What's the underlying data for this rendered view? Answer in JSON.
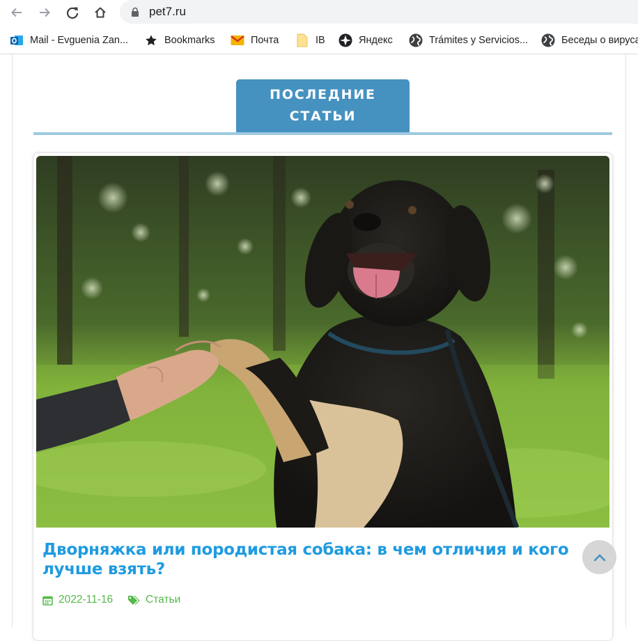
{
  "browser": {
    "url": "pet7.ru",
    "bookmarks": [
      {
        "label": "Mail - Evguenia Zan...",
        "icon": "outlook-icon"
      },
      {
        "label": "Bookmarks",
        "icon": "star-icon"
      },
      {
        "label": "Почта",
        "icon": "gmail-icon"
      },
      {
        "label": "IB",
        "icon": "folder-icon"
      },
      {
        "label": "Яндекс",
        "icon": "compass-icon"
      },
      {
        "label": "Trámites y Servicios...",
        "icon": "globe-icon"
      },
      {
        "label": "Беседы о вирусах",
        "icon": "globe-icon"
      }
    ]
  },
  "section": {
    "tab_line1": "ПОСЛЕДНИЕ",
    "tab_line2": "СТАТЬИ"
  },
  "article": {
    "title": "Дворняжка или породистая собака: в чем отличия и кого лучше взять?",
    "date": "2022-11-16",
    "category": "Статьи",
    "image": "dog-handshake-photo"
  },
  "colors": {
    "accent": "#4592c1",
    "link": "#1f9be0",
    "meta": "#55b94a"
  }
}
